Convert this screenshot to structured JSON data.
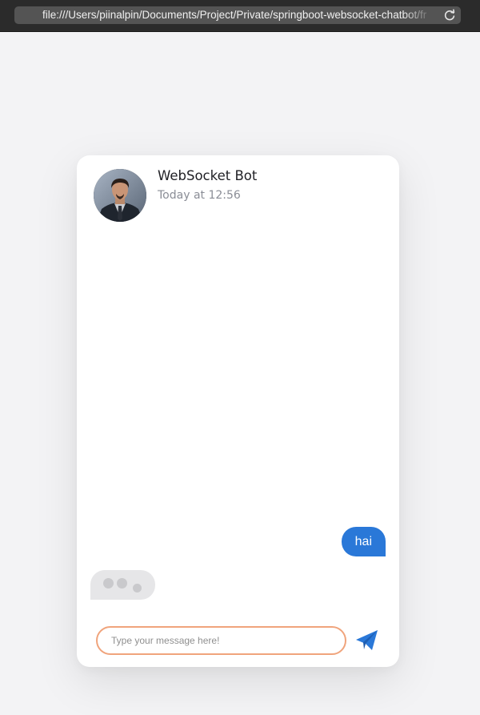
{
  "browser": {
    "url": "file:///Users/piinalpin/Documents/Project/Private/springboot-websocket-chatbot/fr",
    "reload_icon": "reload-icon"
  },
  "chat": {
    "bot_name": "WebSocket Bot",
    "status": "Today at 12:56",
    "avatar_icon": "bot-avatar",
    "messages": [
      {
        "from": "user",
        "text": "hai"
      }
    ],
    "typing_indicator": "typing-dots-icon",
    "input": {
      "value": "",
      "placeholder": "Type your message here!"
    },
    "send_icon": "paper-plane-icon"
  },
  "colors": {
    "accent": "#2a78d8",
    "input_border": "#f0a47c",
    "card_bg": "#ffffff",
    "page_bg": "#f3f3f5",
    "typing_bg": "#e6e6e8"
  }
}
